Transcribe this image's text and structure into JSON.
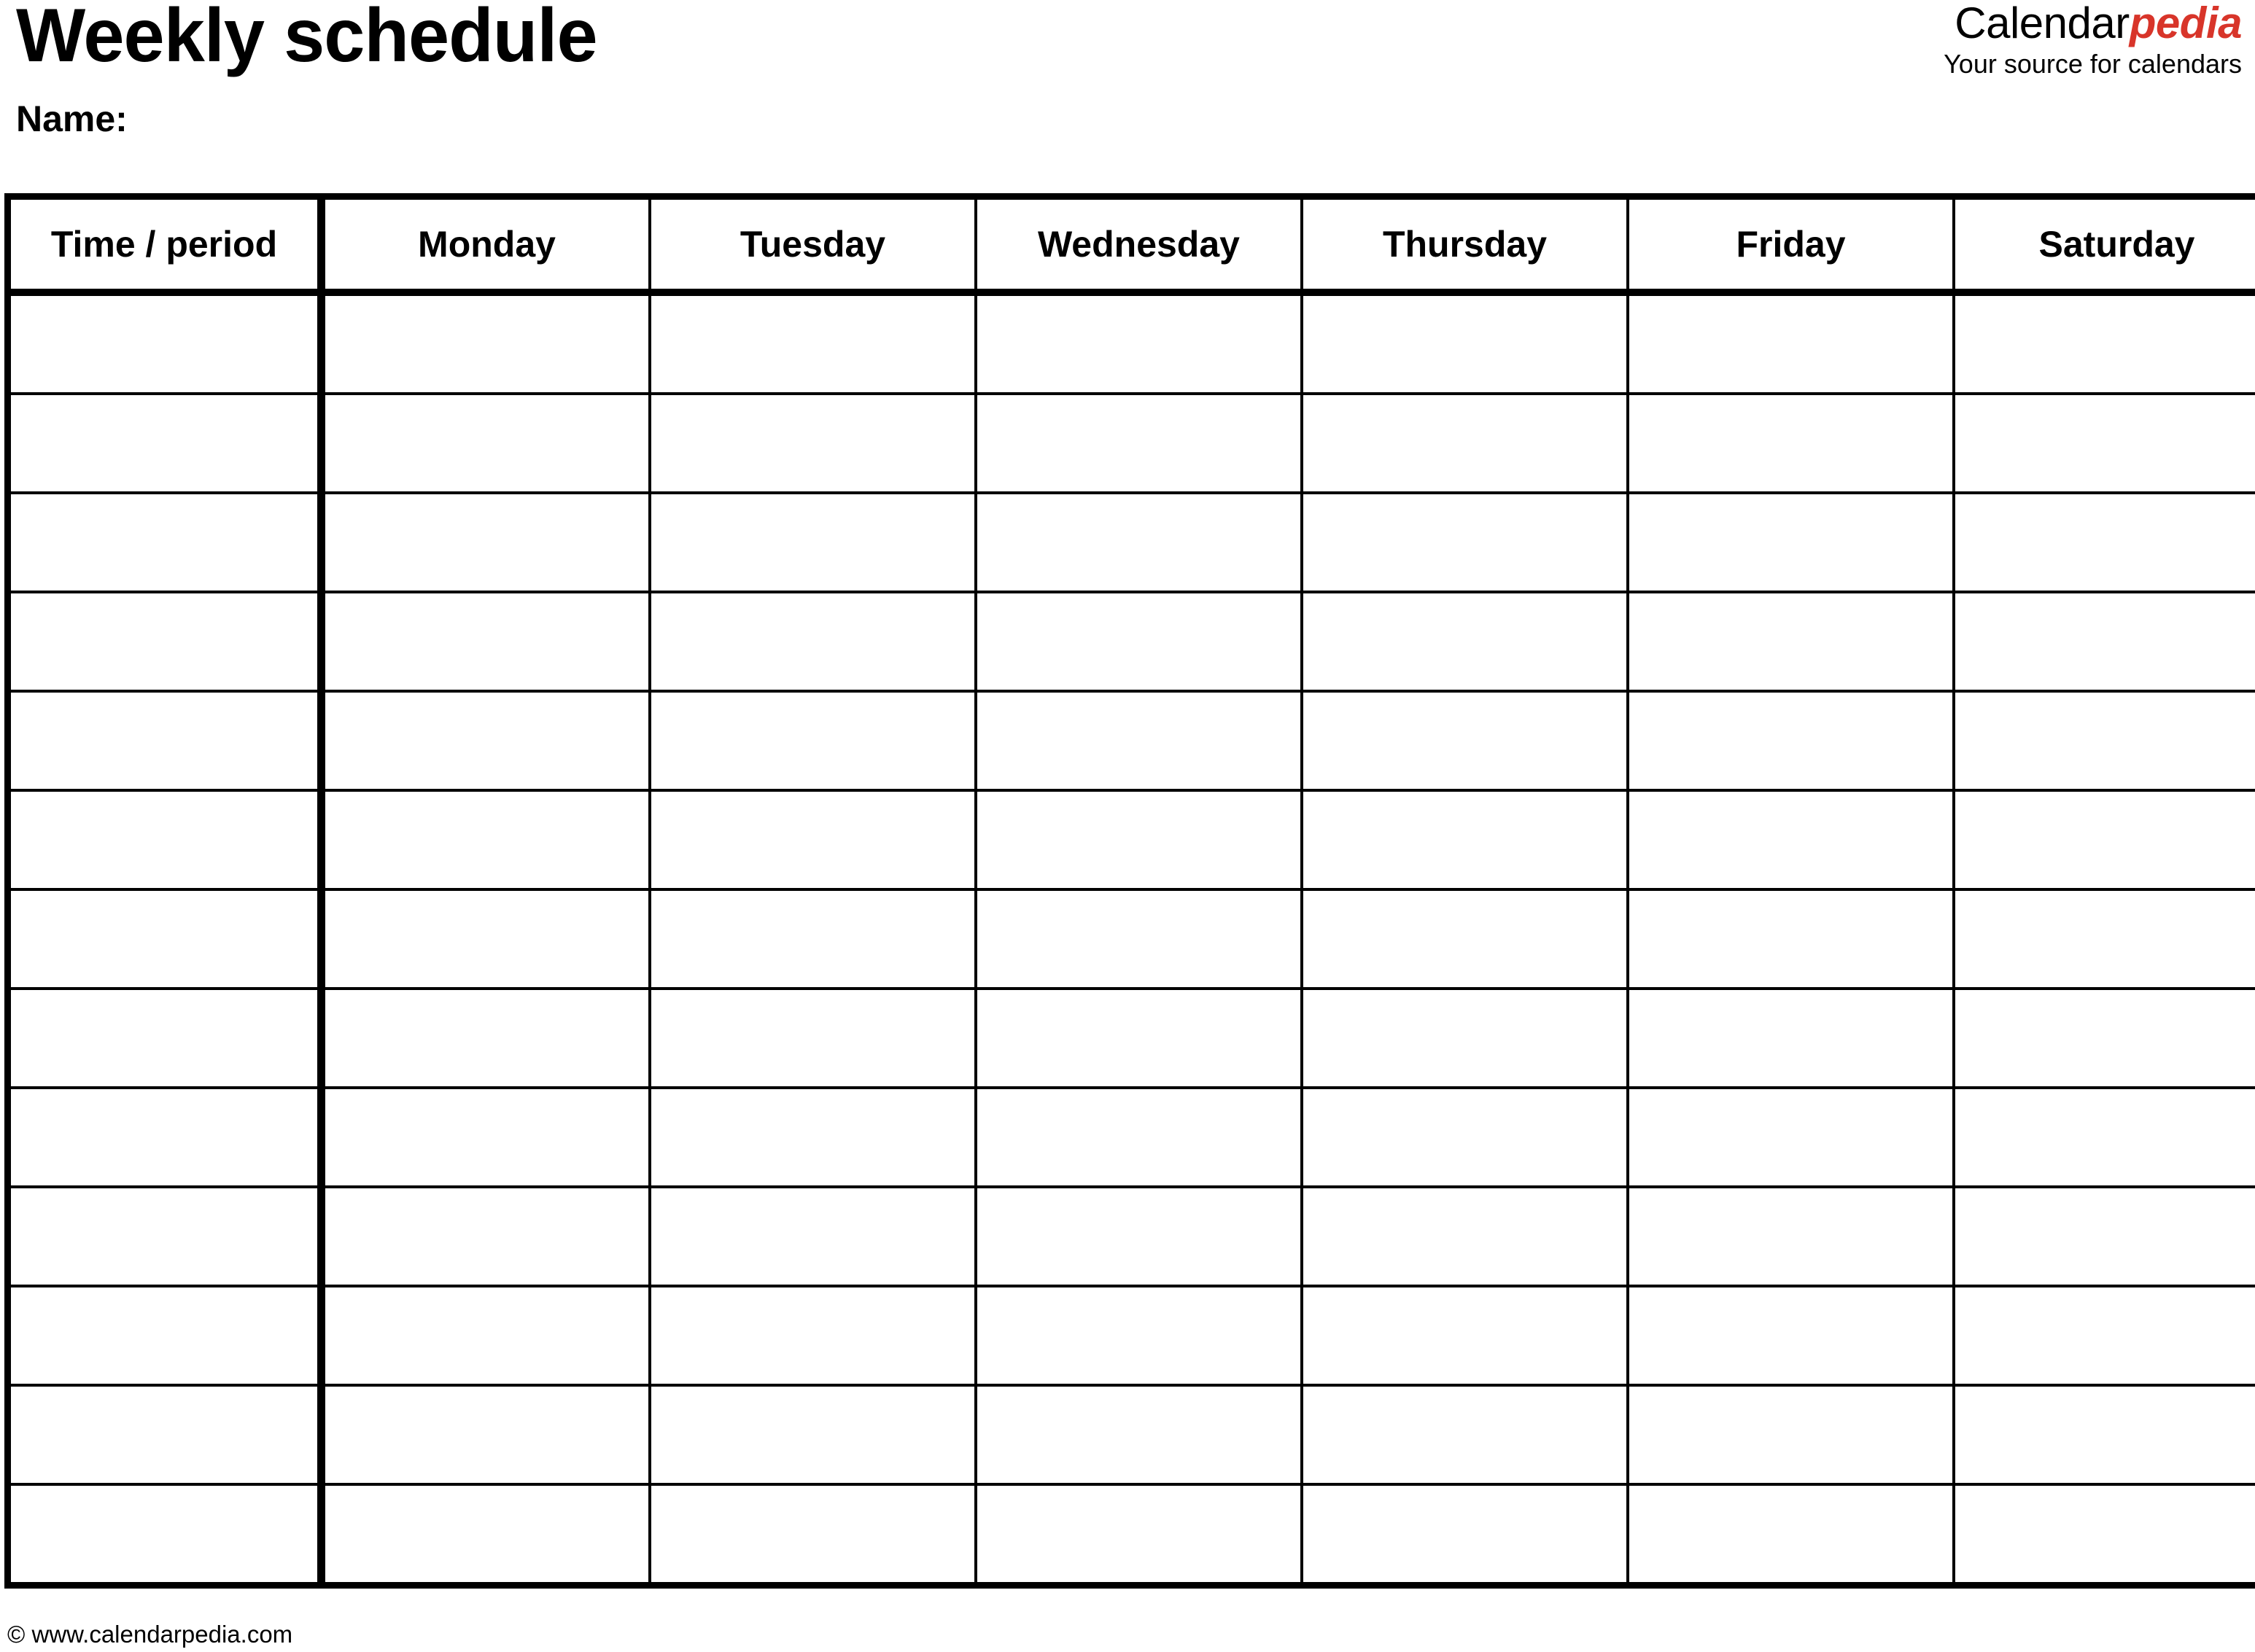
{
  "document": {
    "title": "Weekly schedule",
    "name_label": "Name:"
  },
  "brand": {
    "name_primary": "Calendar",
    "name_accent": "pedia",
    "tagline": "Your source for calendars",
    "accent_color": "#D8352A"
  },
  "table": {
    "columns": [
      {
        "key": "time",
        "label": "Time / period"
      },
      {
        "key": "monday",
        "label": "Monday"
      },
      {
        "key": "tuesday",
        "label": "Tuesday"
      },
      {
        "key": "wednesday",
        "label": "Wednesday"
      },
      {
        "key": "thursday",
        "label": "Thursday"
      },
      {
        "key": "friday",
        "label": "Friday"
      },
      {
        "key": "saturday",
        "label": "Saturday"
      }
    ],
    "row_count": 13,
    "rows": [
      {
        "time": "",
        "monday": "",
        "tuesday": "",
        "wednesday": "",
        "thursday": "",
        "friday": "",
        "saturday": ""
      },
      {
        "time": "",
        "monday": "",
        "tuesday": "",
        "wednesday": "",
        "thursday": "",
        "friday": "",
        "saturday": ""
      },
      {
        "time": "",
        "monday": "",
        "tuesday": "",
        "wednesday": "",
        "thursday": "",
        "friday": "",
        "saturday": ""
      },
      {
        "time": "",
        "monday": "",
        "tuesday": "",
        "wednesday": "",
        "thursday": "",
        "friday": "",
        "saturday": ""
      },
      {
        "time": "",
        "monday": "",
        "tuesday": "",
        "wednesday": "",
        "thursday": "",
        "friday": "",
        "saturday": ""
      },
      {
        "time": "",
        "monday": "",
        "tuesday": "",
        "wednesday": "",
        "thursday": "",
        "friday": "",
        "saturday": ""
      },
      {
        "time": "",
        "monday": "",
        "tuesday": "",
        "wednesday": "",
        "thursday": "",
        "friday": "",
        "saturday": ""
      },
      {
        "time": "",
        "monday": "",
        "tuesday": "",
        "wednesday": "",
        "thursday": "",
        "friday": "",
        "saturday": ""
      },
      {
        "time": "",
        "monday": "",
        "tuesday": "",
        "wednesday": "",
        "thursday": "",
        "friday": "",
        "saturday": ""
      },
      {
        "time": "",
        "monday": "",
        "tuesday": "",
        "wednesday": "",
        "thursday": "",
        "friday": "",
        "saturday": ""
      },
      {
        "time": "",
        "monday": "",
        "tuesday": "",
        "wednesday": "",
        "thursday": "",
        "friday": "",
        "saturday": ""
      },
      {
        "time": "",
        "monday": "",
        "tuesday": "",
        "wednesday": "",
        "thursday": "",
        "friday": "",
        "saturday": ""
      },
      {
        "time": "",
        "monday": "",
        "tuesday": "",
        "wednesday": "",
        "thursday": "",
        "friday": "",
        "saturday": ""
      }
    ]
  },
  "footer": {
    "copyright": "© www.calendarpedia.com"
  }
}
